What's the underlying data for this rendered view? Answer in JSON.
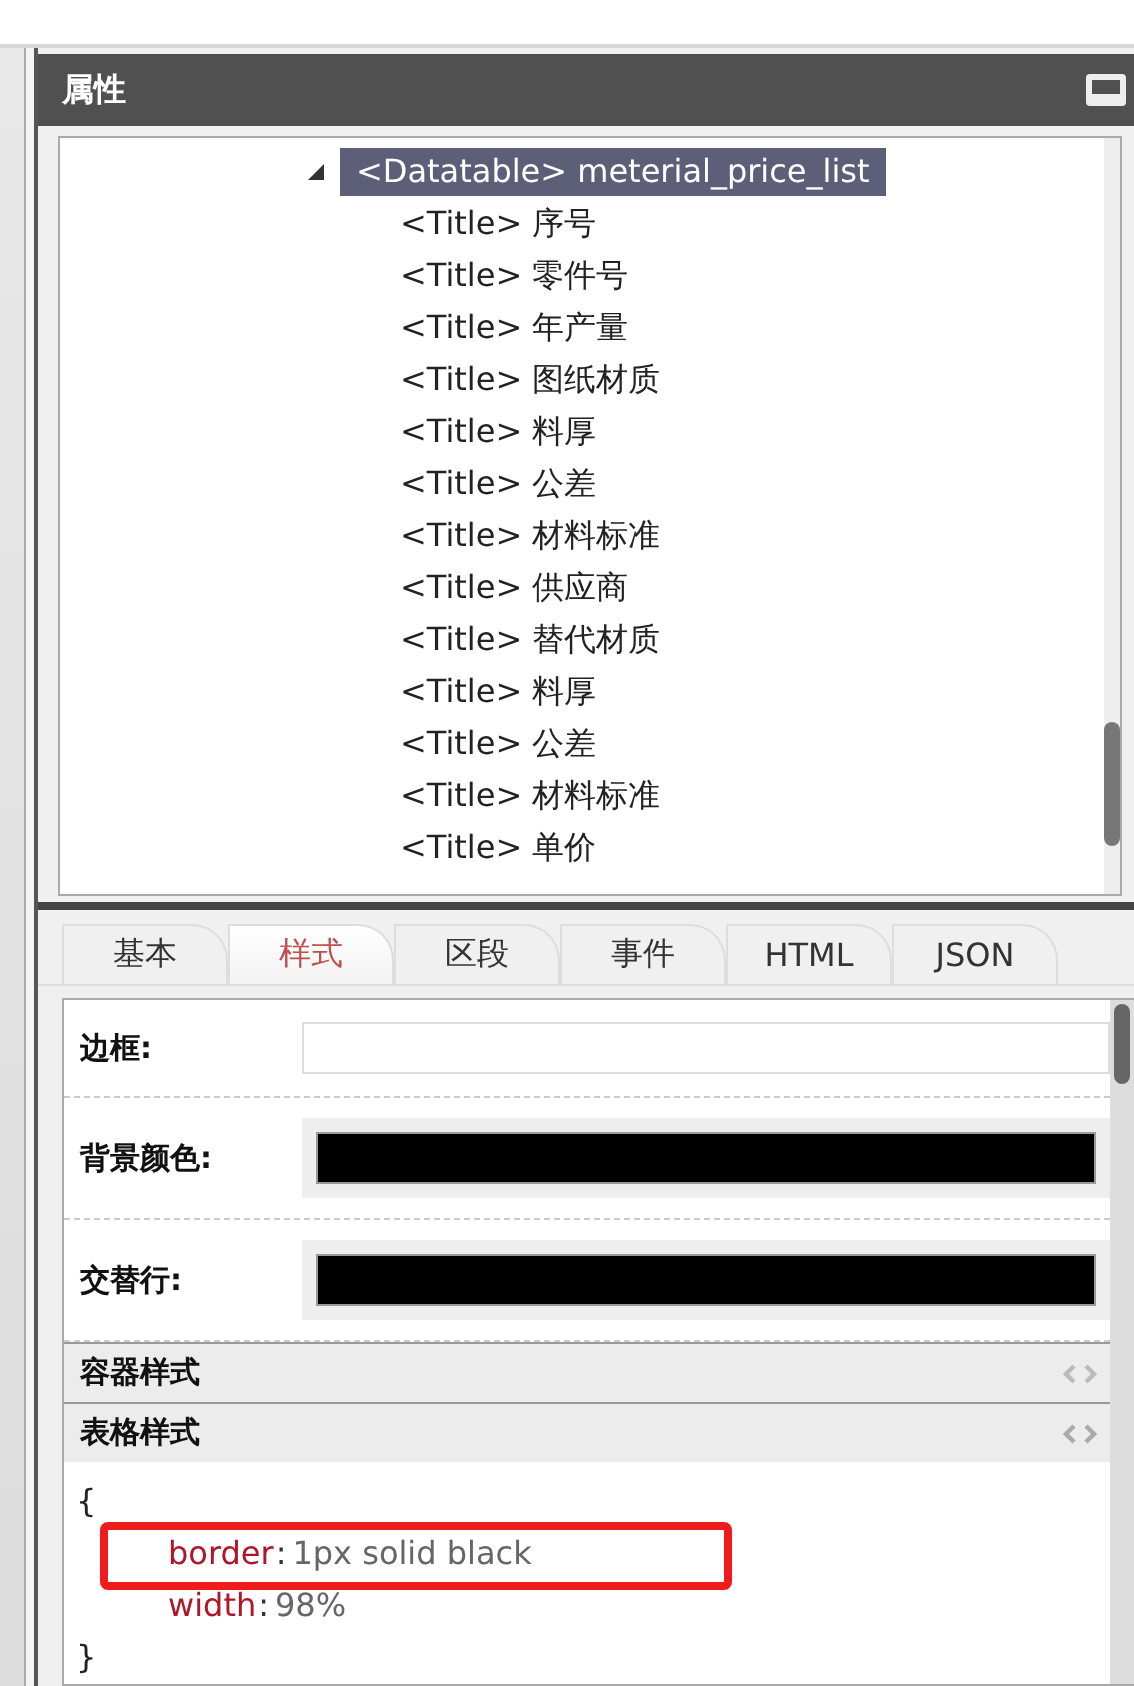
{
  "panel": {
    "title": "属性"
  },
  "tree": {
    "root": {
      "label": "<Datatable> meterial_price_list",
      "selected": true,
      "expanded": true,
      "children": [
        {
          "label": "<Title> 序号",
          "selected": false
        },
        {
          "label": "<Title> 零件号",
          "selected": false
        },
        {
          "label": "<Title> 年产量",
          "selected": false
        },
        {
          "label": "<Title> 图纸材质",
          "selected": false
        },
        {
          "label": "<Title> 料厚",
          "selected": false
        },
        {
          "label": "<Title> 公差",
          "selected": false
        },
        {
          "label": "<Title> 材料标准",
          "selected": false
        },
        {
          "label": "<Title> 供应商",
          "selected": false
        },
        {
          "label": "<Title> 替代材质",
          "selected": false
        },
        {
          "label": "<Title> 料厚",
          "selected": false
        },
        {
          "label": "<Title> 公差",
          "selected": false
        },
        {
          "label": "<Title> 材料标准",
          "selected": false
        },
        {
          "label": "<Title> 单价",
          "selected": false
        }
      ]
    }
  },
  "tabs": [
    {
      "label": "基本",
      "selected": false
    },
    {
      "label": "样式",
      "selected": true
    },
    {
      "label": "区段",
      "selected": false
    },
    {
      "label": "事件",
      "selected": false
    },
    {
      "label": "HTML",
      "selected": false
    },
    {
      "label": "JSON",
      "selected": false
    }
  ],
  "fields": [
    {
      "label": "边框:",
      "kind": "text"
    },
    {
      "label": "背景颜色:",
      "kind": "color",
      "color": "#000000"
    },
    {
      "label": "交替行:",
      "kind": "color",
      "color": "#000000"
    }
  ],
  "sections": [
    {
      "title": "容器样式",
      "expanded": false
    },
    {
      "title": "表格样式",
      "expanded": true
    }
  ],
  "code": [
    {
      "kind": "brace",
      "text": "{"
    },
    {
      "kind": "prop",
      "name": "border",
      "separator": ":",
      "value": "1px solid black",
      "highlighted": true
    },
    {
      "kind": "prop",
      "name": "width",
      "separator": ":",
      "value": "98%",
      "highlighted": false
    },
    {
      "kind": "brace",
      "text": "}"
    }
  ]
}
